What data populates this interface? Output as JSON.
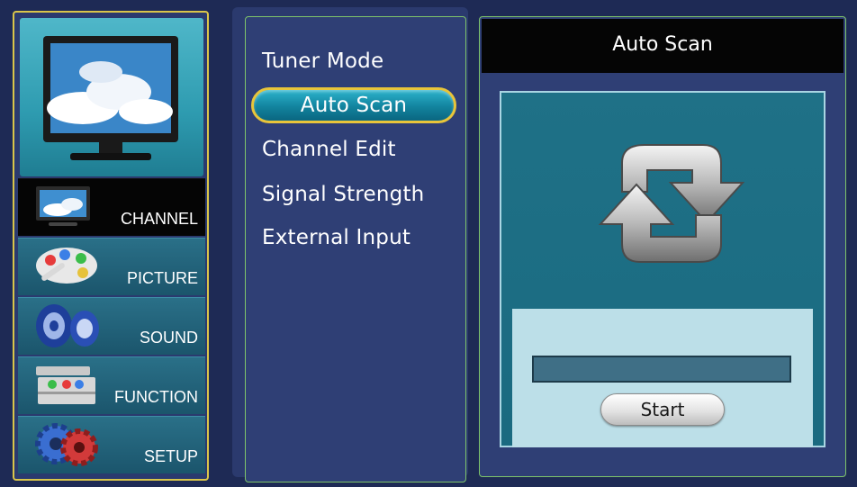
{
  "sidebar": {
    "categories": [
      {
        "label": "CHANNEL",
        "icon": "tv-icon",
        "active": true
      },
      {
        "label": "PICTURE",
        "icon": "palette-icon",
        "active": false
      },
      {
        "label": "SOUND",
        "icon": "speaker-icon",
        "active": false
      },
      {
        "label": "FUNCTION",
        "icon": "toolbox-icon",
        "active": false
      },
      {
        "label": "SETUP",
        "icon": "gears-icon",
        "active": false
      }
    ]
  },
  "menu": {
    "items": [
      {
        "label": "Tuner Mode",
        "selected": false
      },
      {
        "label": "Auto Scan",
        "selected": true
      },
      {
        "label": "Channel Edit",
        "selected": false
      },
      {
        "label": "Signal Strength",
        "selected": false
      },
      {
        "label": "External Input",
        "selected": false
      }
    ]
  },
  "panel": {
    "title": "Auto Scan",
    "icon": "refresh-icon",
    "progress": 0,
    "start_label": "Start"
  },
  "colors": {
    "background": "#1e2a55",
    "accent_gold": "#e8c53a",
    "highlight_teal": "#12839e",
    "border_green": "#7ec46a"
  }
}
